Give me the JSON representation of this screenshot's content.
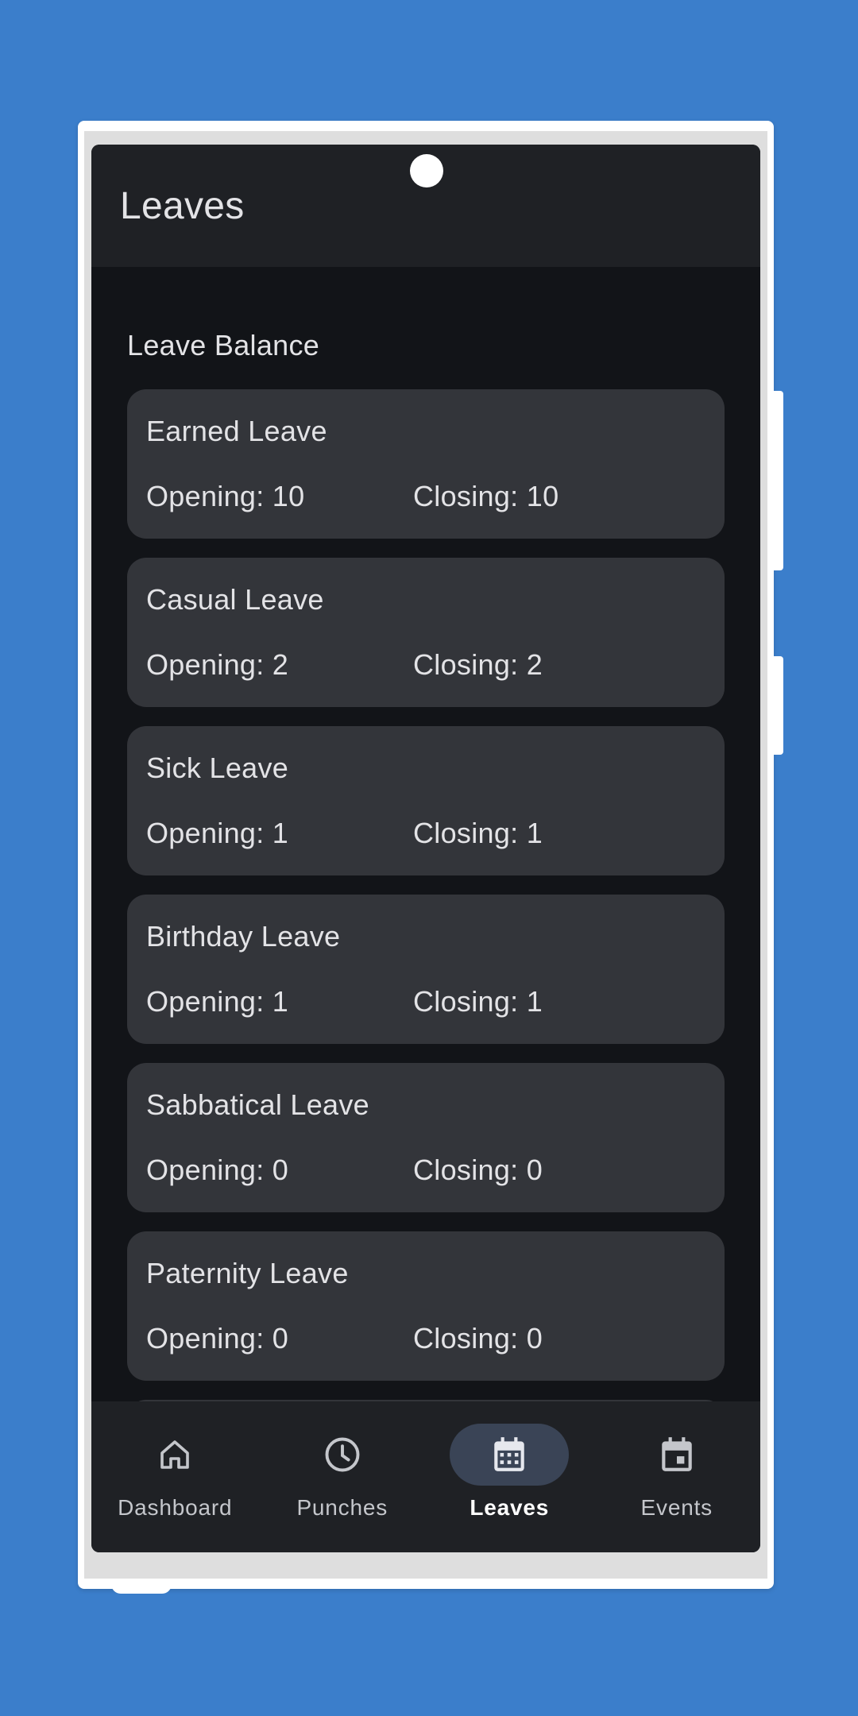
{
  "app": {
    "title": "Leaves"
  },
  "section": {
    "title": "Leave Balance"
  },
  "leaves": [
    {
      "name": "Earned Leave",
      "opening": "Opening: 10",
      "closing": "Closing: 10"
    },
    {
      "name": "Casual Leave",
      "opening": "Opening: 2",
      "closing": "Closing: 2"
    },
    {
      "name": "Sick Leave",
      "opening": "Opening: 1",
      "closing": "Closing: 1"
    },
    {
      "name": "Birthday Leave",
      "opening": "Opening: 1",
      "closing": "Closing: 1"
    },
    {
      "name": "Sabbatical Leave",
      "opening": "Opening: 0",
      "closing": "Closing: 0"
    },
    {
      "name": "Paternity Leave",
      "opening": "Opening: 0",
      "closing": "Closing: 0"
    }
  ],
  "nav": {
    "items": [
      {
        "label": "Dashboard",
        "icon": "home-icon",
        "active": false
      },
      {
        "label": "Punches",
        "icon": "clock-icon",
        "active": false
      },
      {
        "label": "Leaves",
        "icon": "calendar-grid-icon",
        "active": true
      },
      {
        "label": "Events",
        "icon": "calendar-event-icon",
        "active": false
      }
    ]
  },
  "colors": {
    "background": "#3b7ecb",
    "screen": "#121418",
    "app_bar": "#1f2125",
    "card": "#33353a",
    "active_indicator": "#3a4456",
    "text": "#e3e3e6"
  }
}
